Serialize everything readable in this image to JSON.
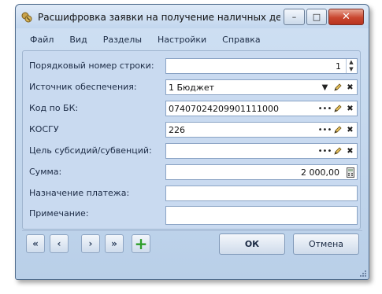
{
  "window": {
    "title": "Расшифровка заявки на получение наличных денег :: ...",
    "controls": {
      "minimize": "–",
      "maximize": "□",
      "close": "✕"
    }
  },
  "menu": [
    "Файл",
    "Вид",
    "Разделы",
    "Настройки",
    "Справка"
  ],
  "form": {
    "row_number": {
      "label": "Порядковый номер строки:",
      "value": "1"
    },
    "source": {
      "label": "Источник обеспечения:",
      "value": "1 Бюджет"
    },
    "bk_code": {
      "label": "Код по БК:",
      "value": "07407024209901111000"
    },
    "kosgu": {
      "label": "КОСГУ",
      "value": "226"
    },
    "subsidy_goal": {
      "label": "Цель субсидий/субвенций:",
      "value": ""
    },
    "amount": {
      "label": "Сумма:",
      "value": "2 000,00"
    },
    "purpose": {
      "label": "Назначение платежа:",
      "value": ""
    },
    "note": {
      "label": "Примечание:",
      "value": ""
    }
  },
  "navigation": {
    "first": "«",
    "prev": "‹",
    "next": "›",
    "last": "»",
    "add": "+"
  },
  "buttons": {
    "ok": "ОК",
    "cancel": "Отмена"
  },
  "icons": [
    "app-icon",
    "dropdown-icon",
    "ellipsis-icon",
    "edit-icon",
    "clear-icon",
    "calculator-icon",
    "plus-icon"
  ],
  "colors": {
    "form_background": "#c9daf0",
    "close_button": "#c9462f",
    "add_button": "#2e9e2a"
  }
}
